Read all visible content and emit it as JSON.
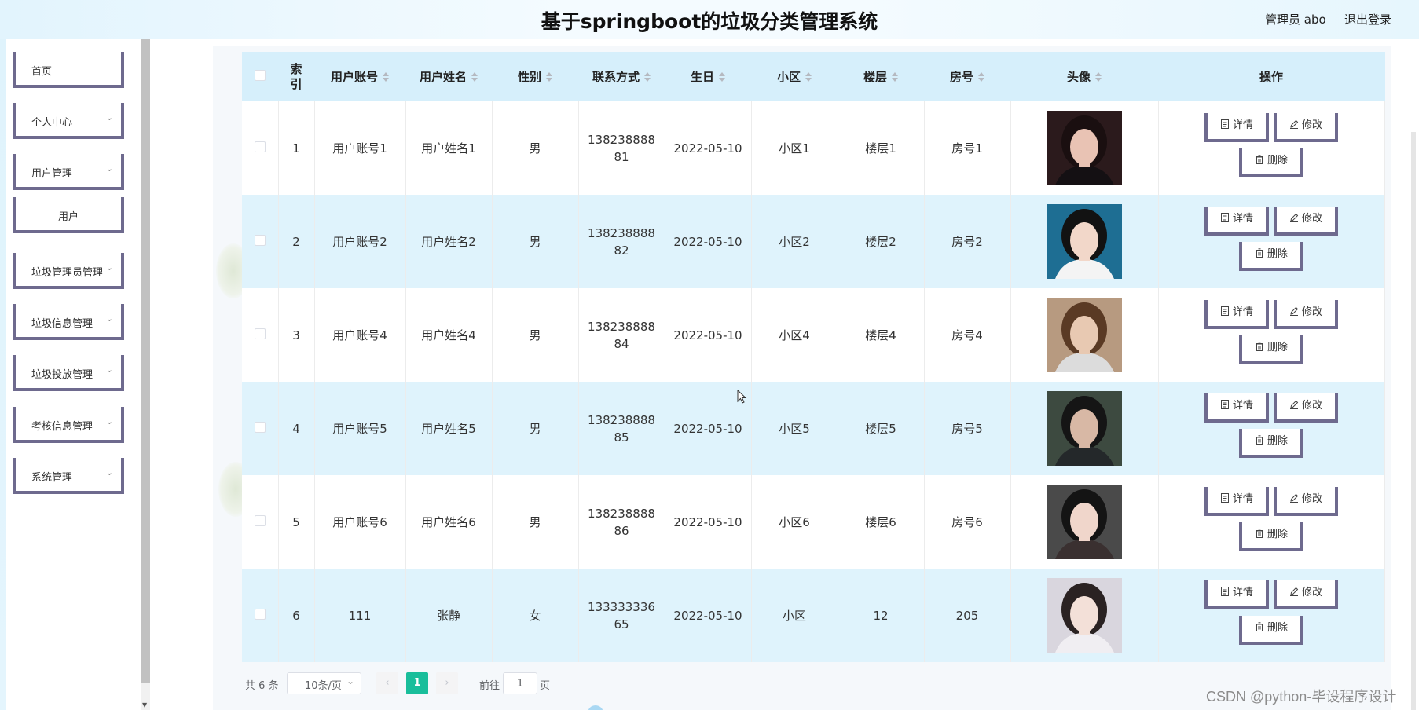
{
  "header": {
    "title": "基于springboot的垃圾分类管理系统",
    "user": "管理员 abo",
    "logout": "退出登录"
  },
  "sidebar": {
    "items": [
      {
        "label": "首页",
        "chevron": false,
        "center": false
      },
      {
        "label": "个人中心",
        "chevron": true,
        "center": false
      },
      {
        "label": "用户管理",
        "chevron": true,
        "center": false
      },
      {
        "label": "用户",
        "chevron": false,
        "center": true
      },
      {
        "label": "垃圾管理员管理",
        "chevron": true,
        "center": false
      },
      {
        "label": "垃圾信息管理",
        "chevron": true,
        "center": false
      },
      {
        "label": "垃圾投放管理",
        "chevron": true,
        "center": false
      },
      {
        "label": "考核信息管理",
        "chevron": true,
        "center": false
      },
      {
        "label": "系统管理",
        "chevron": true,
        "center": false
      }
    ]
  },
  "table": {
    "headers": {
      "index": "索\n引",
      "account": "用户账号",
      "name": "用户姓名",
      "gender": "性别",
      "phone": "联系方式",
      "birthday": "生日",
      "community": "小区",
      "floor": "楼层",
      "room": "房号",
      "avatar": "头像",
      "ops": "操作"
    },
    "rows": [
      {
        "index": "1",
        "account": "用户账号1",
        "name": "用户姓名1",
        "gender": "男",
        "phone": "13823888881",
        "birthday": "2022-05-10",
        "community": "小区1",
        "floor": "楼层1",
        "room": "房号1"
      },
      {
        "index": "2",
        "account": "用户账号2",
        "name": "用户姓名2",
        "gender": "男",
        "phone": "13823888882",
        "birthday": "2022-05-10",
        "community": "小区2",
        "floor": "楼层2",
        "room": "房号2"
      },
      {
        "index": "3",
        "account": "用户账号4",
        "name": "用户姓名4",
        "gender": "男",
        "phone": "13823888884",
        "birthday": "2022-05-10",
        "community": "小区4",
        "floor": "楼层4",
        "room": "房号4"
      },
      {
        "index": "4",
        "account": "用户账号5",
        "name": "用户姓名5",
        "gender": "男",
        "phone": "13823888885",
        "birthday": "2022-05-10",
        "community": "小区5",
        "floor": "楼层5",
        "room": "房号5"
      },
      {
        "index": "5",
        "account": "用户账号6",
        "name": "用户姓名6",
        "gender": "男",
        "phone": "13823888886",
        "birthday": "2022-05-10",
        "community": "小区6",
        "floor": "楼层6",
        "room": "房号6"
      },
      {
        "index": "6",
        "account": "111",
        "name": "张静",
        "gender": "女",
        "phone": "13333333665",
        "birthday": "2022-05-10",
        "community": "小区",
        "floor": "12",
        "room": "205"
      }
    ],
    "actions": {
      "detail": "详情",
      "edit": "修改",
      "delete": "删除"
    }
  },
  "pagination": {
    "total": "共 6 条",
    "page_size": "10条/页",
    "current_page": "1",
    "goto_label": "前往",
    "goto_value": "1",
    "page_unit": "页"
  },
  "watermark": "CSDN @python-毕设程序设计",
  "colors": {
    "header_bg": "#d6effb",
    "row_alt": "#dff3fc",
    "accent_border": "#6e6a8e",
    "page_active": "#19be9b"
  }
}
